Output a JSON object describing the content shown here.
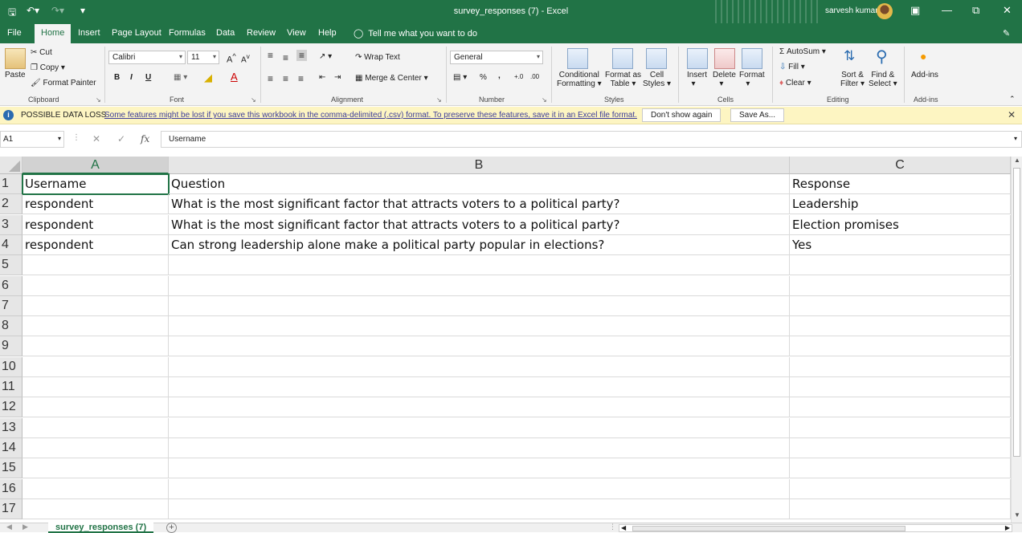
{
  "titlebar": {
    "title": "survey_responses (7)  -  Excel",
    "user": "sarvesh kumar",
    "save_icon": "save-icon",
    "undo_icon": "undo-icon",
    "redo_icon": "redo-icon",
    "customize_icon": "customize-qat-icon",
    "ribbon_display_icon": "ribbon-display-options-icon",
    "minimize_icon": "minimize-icon",
    "restore_icon": "restore-icon",
    "close_icon": "close-icon"
  },
  "tabs": [
    "File",
    "Home",
    "Insert",
    "Page Layout",
    "Formulas",
    "Data",
    "Review",
    "View",
    "Help"
  ],
  "tellme": "Tell me what you want to do",
  "ribbon": {
    "clipboard": {
      "paste": "Paste",
      "cut": "Cut",
      "copy": "Copy",
      "format_painter": "Format Painter",
      "label": "Clipboard"
    },
    "font": {
      "name": "Calibri",
      "size": "11",
      "label": "Font",
      "bold": "B",
      "italic": "I",
      "underline": "U"
    },
    "alignment": {
      "wrap": "Wrap Text",
      "merge": "Merge & Center",
      "label": "Alignment"
    },
    "number": {
      "format": "General",
      "label": "Number",
      "percent": "%",
      "comma": ","
    },
    "styles": {
      "conditional": "Conditional",
      "conditional2": "Formatting",
      "format_as": "Format as",
      "format_as2": "Table",
      "cell": "Cell",
      "cell2": "Styles",
      "label": "Styles"
    },
    "cells": {
      "insert": "Insert",
      "delete": "Delete",
      "format": "Format",
      "label": "Cells"
    },
    "editing": {
      "autosum": "AutoSum",
      "fill": "Fill",
      "clear": "Clear",
      "sort": "Sort &",
      "sort2": "Filter",
      "find": "Find &",
      "find2": "Select",
      "label": "Editing"
    },
    "addins": {
      "addins": "Add-ins",
      "label": "Add-ins"
    }
  },
  "infobar": {
    "label": "POSSIBLE DATA LOSS",
    "message": "Some features might be lost if you save this workbook in the comma-delimited (.csv) format. To preserve these features, save it in an Excel file format.",
    "dont_show": "Don't show again",
    "save_as": "Save As..."
  },
  "formula_bar": {
    "name_box": "A1",
    "value": "Username",
    "fx": "fx"
  },
  "columns": [
    "A",
    "B",
    "C"
  ],
  "rows": [
    [
      "Username",
      "Question",
      "Response"
    ],
    [
      "respondent",
      "What is the most significant factor that attracts voters to a political party?",
      "Leadership"
    ],
    [
      "respondent",
      "What is the most significant factor that attracts voters to a political party?",
      "Election promises"
    ],
    [
      "respondent",
      "Can strong leadership alone make a political party popular in elections?",
      "Yes"
    ],
    [
      "",
      "",
      ""
    ],
    [
      "",
      "",
      ""
    ],
    [
      "",
      "",
      ""
    ],
    [
      "",
      "",
      ""
    ],
    [
      "",
      "",
      ""
    ],
    [
      "",
      "",
      ""
    ],
    [
      "",
      "",
      ""
    ],
    [
      "",
      "",
      ""
    ],
    [
      "",
      "",
      ""
    ],
    [
      "",
      "",
      ""
    ],
    [
      "",
      "",
      ""
    ],
    [
      "",
      "",
      ""
    ],
    [
      "",
      "",
      ""
    ]
  ],
  "row_numbers": [
    "1",
    "2",
    "3",
    "4",
    "5",
    "6",
    "7",
    "8",
    "9",
    "10",
    "11",
    "12",
    "13",
    "14",
    "15",
    "16",
    "17"
  ],
  "sheet_tab": "survey_responses (7)",
  "add_sheet": "+"
}
